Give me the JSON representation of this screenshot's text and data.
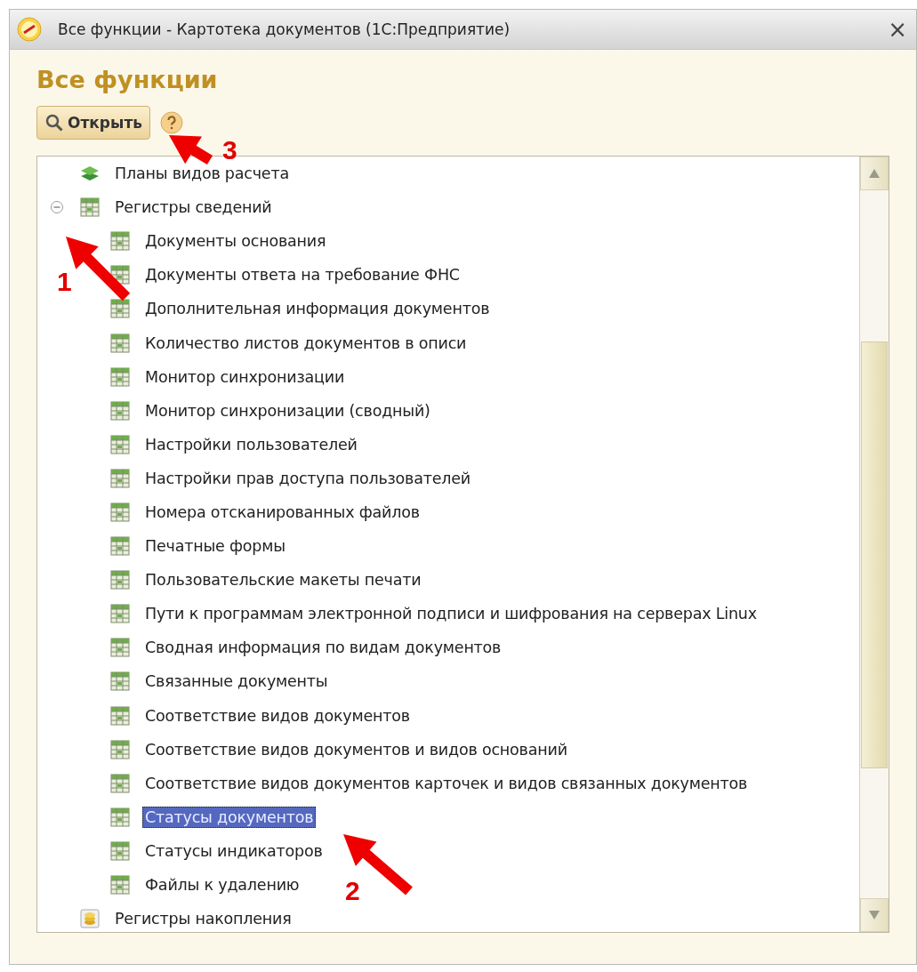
{
  "window": {
    "title": "Все функции - Картотека документов  (1С:Предприятие)",
    "close": "×"
  },
  "heading": "Все функции",
  "toolbar": {
    "open_button": "Открыть"
  },
  "tree": [
    {
      "label": "Планы видов расчета",
      "kind": "plans",
      "selected": false
    },
    {
      "label": "Регистры сведений",
      "kind": "register",
      "selected": false,
      "expanded": true,
      "children": [
        {
          "label": "Документы основания",
          "kind": "register",
          "selected": false
        },
        {
          "label": "Документы ответа на требование ФНС",
          "kind": "register",
          "selected": false
        },
        {
          "label": "Дополнительная информация документов",
          "kind": "register",
          "selected": false
        },
        {
          "label": "Количество листов документов в описи",
          "kind": "register",
          "selected": false
        },
        {
          "label": "Монитор синхронизации",
          "kind": "register",
          "selected": false
        },
        {
          "label": "Монитор синхронизации (сводный)",
          "kind": "register",
          "selected": false
        },
        {
          "label": "Настройки пользователей",
          "kind": "register",
          "selected": false
        },
        {
          "label": "Настройки прав доступа пользователей",
          "kind": "register",
          "selected": false
        },
        {
          "label": "Номера отсканированных файлов",
          "kind": "register",
          "selected": false
        },
        {
          "label": "Печатные формы",
          "kind": "register",
          "selected": false
        },
        {
          "label": "Пользовательские макеты печати",
          "kind": "register",
          "selected": false
        },
        {
          "label": "Пути к программам электронной подписи и шифрования на серверах Linux",
          "kind": "register",
          "selected": false
        },
        {
          "label": "Сводная информация по видам документов",
          "kind": "register",
          "selected": false
        },
        {
          "label": "Связанные документы",
          "kind": "register",
          "selected": false
        },
        {
          "label": "Соответствие видов документов",
          "kind": "register",
          "selected": false
        },
        {
          "label": "Соответствие видов документов и видов оснований",
          "kind": "register",
          "selected": false
        },
        {
          "label": "Соответствие видов документов карточек и видов связанных документов",
          "kind": "register",
          "selected": false
        },
        {
          "label": "Статусы документов",
          "kind": "register",
          "selected": true
        },
        {
          "label": "Статусы индикаторов",
          "kind": "register",
          "selected": false
        },
        {
          "label": "Файлы к удалению",
          "kind": "register",
          "selected": false
        }
      ]
    },
    {
      "label": "Регистры накопления",
      "kind": "accumulation",
      "selected": false
    }
  ],
  "annotations": [
    {
      "label": "1"
    },
    {
      "label": "2"
    },
    {
      "label": "3"
    }
  ]
}
